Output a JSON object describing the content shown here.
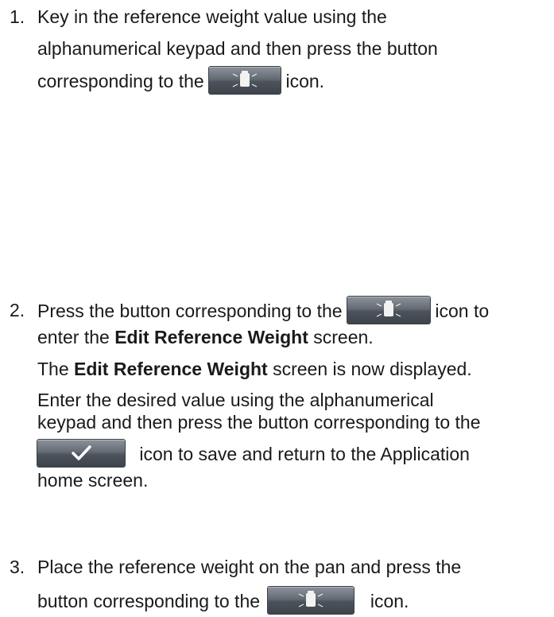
{
  "steps": [
    {
      "number": "1.",
      "line1": "Key in the reference weight value using the",
      "line2": "alphanumerical keypad and then press the button",
      "line3_before": "corresponding to the",
      "line3_after": "icon.",
      "icon": "reference-weight-icon"
    },
    {
      "number": "2.",
      "line1_before": "Press the button corresponding to the",
      "line1_after": "icon to",
      "line2_before": "enter the",
      "line2_bold": "Edit Reference Weight",
      "line2_after": "screen.",
      "line3_before": "The",
      "line3_bold": "Edit Reference Weight",
      "line3_after": "screen is now displayed.",
      "line4": "Enter the desired value using the alphanumerical",
      "line5": "keypad and then press the button corresponding to the",
      "line6_after": "icon to save and return to the Application",
      "line7": "home screen.",
      "icon": "reference-weight-icon",
      "confirm_icon": "checkmark-icon"
    },
    {
      "number": "3.",
      "line1": "Place the reference weight on the pan and press the",
      "line2_before": "button corresponding to the",
      "line2_after": "icon.",
      "icon": "reference-weight-icon"
    }
  ]
}
